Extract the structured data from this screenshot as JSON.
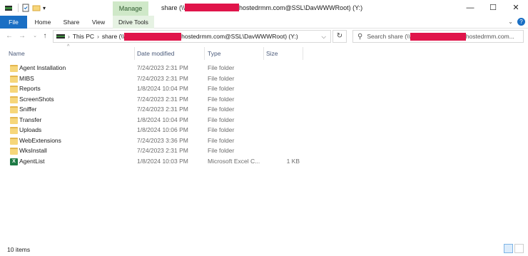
{
  "window": {
    "title_prefix": "share (\\\\",
    "title_suffix": "hostedrmm.com@SSL\\DavWWWRoot) (Y:)",
    "context_tab": "Manage",
    "minimize": "—",
    "maximize": "☐",
    "close": "✕"
  },
  "ribbon": {
    "tabs": [
      "File",
      "Home",
      "Share",
      "View",
      "Drive Tools"
    ],
    "help": "?"
  },
  "address": {
    "crumb_root": "This PC",
    "crumb_sep": "›",
    "crumb_prefix": "share (\\\\",
    "crumb_suffix": "hostedrmm.com@SSL\\DavWWWRoot) (Y:)",
    "dropdown": "⌵",
    "refresh": "↻"
  },
  "search": {
    "prefix": "Search share (\\\\",
    "suffix": "hostedrmm.com..."
  },
  "columns": {
    "name": "Name",
    "date": "Date modified",
    "type": "Type",
    "size": "Size"
  },
  "files": [
    {
      "name": "Agent Installation",
      "date": "7/24/2023 2:31 PM",
      "type": "File folder",
      "size": "",
      "icon": "folder-icon"
    },
    {
      "name": "MIBS",
      "date": "7/24/2023 2:31 PM",
      "type": "File folder",
      "size": "",
      "icon": "folder-icon"
    },
    {
      "name": "Reports",
      "date": "1/8/2024 10:04 PM",
      "type": "File folder",
      "size": "",
      "icon": "folder-icon"
    },
    {
      "name": "ScreenShots",
      "date": "7/24/2023 2:31 PM",
      "type": "File folder",
      "size": "",
      "icon": "folder-icon"
    },
    {
      "name": "Sniffer",
      "date": "7/24/2023 2:31 PM",
      "type": "File folder",
      "size": "",
      "icon": "folder-icon"
    },
    {
      "name": "Transfer",
      "date": "1/8/2024 10:04 PM",
      "type": "File folder",
      "size": "",
      "icon": "folder-icon"
    },
    {
      "name": "Uploads",
      "date": "1/8/2024 10:06 PM",
      "type": "File folder",
      "size": "",
      "icon": "folder-icon"
    },
    {
      "name": "WebExtensions",
      "date": "7/24/2023 3:36 PM",
      "type": "File folder",
      "size": "",
      "icon": "folder-icon"
    },
    {
      "name": "WksInstall",
      "date": "7/24/2023 2:31 PM",
      "type": "File folder",
      "size": "",
      "icon": "folder-icon"
    },
    {
      "name": "AgentList",
      "date": "1/8/2024 10:03 PM",
      "type": "Microsoft Excel C...",
      "size": "1 KB",
      "icon": "excel-icon"
    }
  ],
  "status": {
    "items": "10 items"
  },
  "colors": {
    "accent": "#1a6fc4",
    "manage_tab": "#cfe8c8",
    "redaction": "#e0144a",
    "folder": "#f6d67a"
  }
}
